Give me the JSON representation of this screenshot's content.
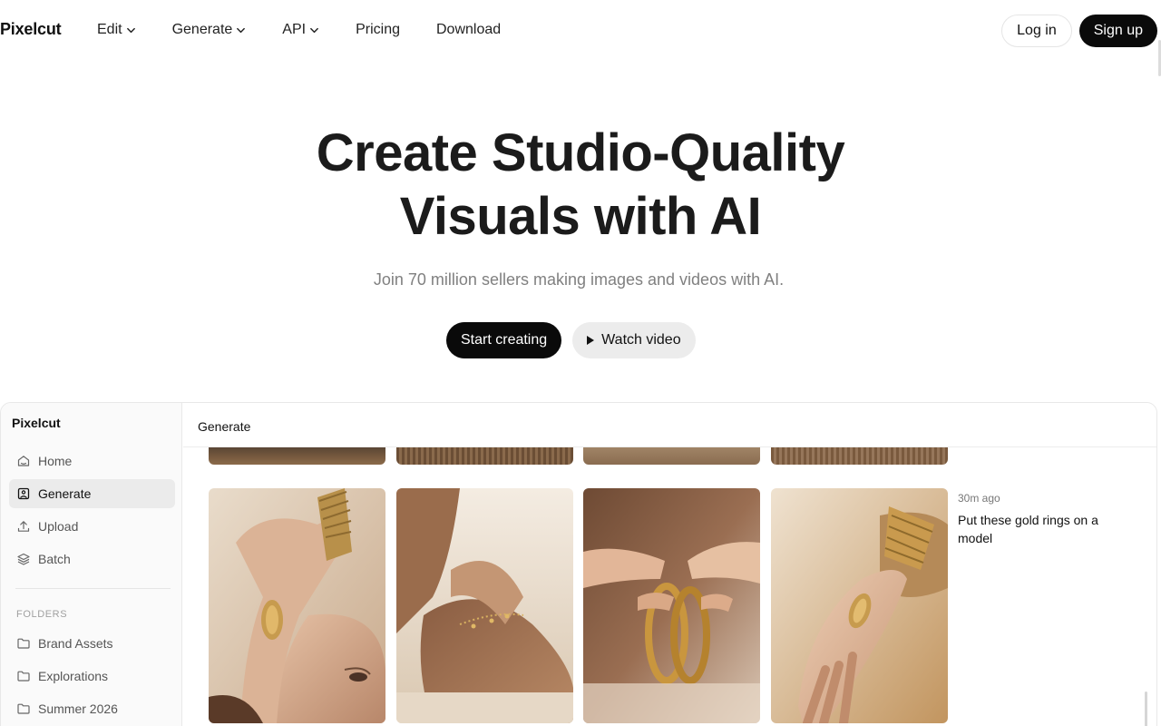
{
  "nav": {
    "logo": "Pixelcut",
    "links": [
      {
        "label": "Edit",
        "dropdown": true
      },
      {
        "label": "Generate",
        "dropdown": true
      },
      {
        "label": "API",
        "dropdown": true
      },
      {
        "label": "Pricing",
        "dropdown": false
      },
      {
        "label": "Download",
        "dropdown": false
      }
    ],
    "login_label": "Log in",
    "signup_label": "Sign up"
  },
  "hero": {
    "title_line1": "Create Studio-Quality",
    "title_line2": "Visuals with AI",
    "subtitle": "Join 70 million sellers making images and videos with AI.",
    "primary_cta": "Start creating",
    "secondary_cta": "Watch video"
  },
  "app": {
    "brand": "Pixelcut",
    "sidebar_items": [
      {
        "label": "Home",
        "icon": "home-icon",
        "active": false
      },
      {
        "label": "Generate",
        "icon": "image-icon",
        "active": true
      },
      {
        "label": "Upload",
        "icon": "upload-icon",
        "active": false
      },
      {
        "label": "Batch",
        "icon": "layers-icon",
        "active": false
      }
    ],
    "folders_label": "FOLDERS",
    "folders": [
      {
        "label": "Brand Assets",
        "icon": "folder-icon"
      },
      {
        "label": "Explorations",
        "icon": "folder-icon"
      },
      {
        "label": "Summer 2026",
        "icon": "folder-icon"
      }
    ],
    "main_title": "Generate",
    "generation": {
      "time": "30m ago",
      "prompt": "Put these gold rings on a model"
    }
  },
  "colors": {
    "primary_button": "#0a0a0a",
    "secondary_button": "#ececec",
    "sidebar_bg": "#fafafa",
    "active_item_bg": "#ebebeb",
    "subtitle_text": "#808080"
  }
}
